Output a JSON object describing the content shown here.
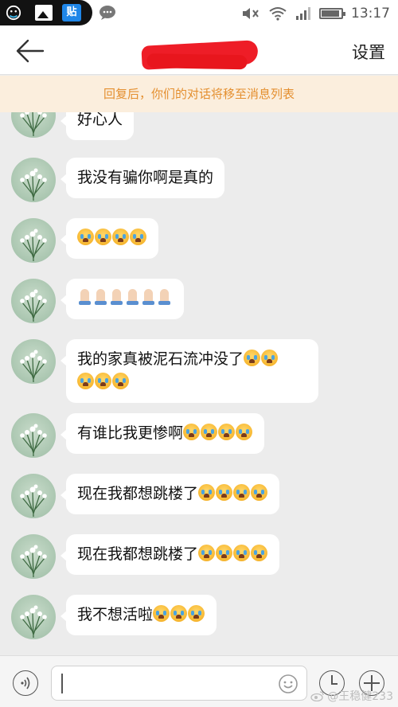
{
  "status_bar": {
    "left_icons": [
      "tie-icon",
      "image-icon",
      "tieba-icon",
      "chat-icon"
    ],
    "tieba_label": "贴",
    "right_icons": [
      "mute-icon",
      "wifi-icon",
      "signal-icon",
      "battery-icon"
    ],
    "time": "13:17"
  },
  "header": {
    "back_icon": "back-arrow-icon",
    "title_redacted": true,
    "settings_label": "设置"
  },
  "banner": {
    "text": "回复后，你们的对话将移至消息列表"
  },
  "messages": [
    {
      "text": "好心人"
    },
    {
      "text": "我没有骗你啊是真的"
    },
    {
      "text": "",
      "emoji": [
        "crying",
        "crying",
        "crying",
        "crying"
      ]
    },
    {
      "text": "",
      "emoji": [
        "praying",
        "praying",
        "praying",
        "praying",
        "praying",
        "praying"
      ]
    },
    {
      "text": "我的家真被泥石流冲没了",
      "emoji": [
        "crying",
        "crying",
        "crying",
        "crying",
        "crying"
      ]
    },
    {
      "text": "有谁比我更惨啊",
      "emoji": [
        "crying",
        "crying",
        "crying",
        "crying"
      ]
    },
    {
      "text": "现在我都想跳楼了",
      "emoji": [
        "crying",
        "crying",
        "crying",
        "crying"
      ]
    },
    {
      "text": "现在我都想跳楼了",
      "emoji": [
        "crying",
        "crying",
        "crying",
        "crying"
      ]
    },
    {
      "text": "我不想活啦",
      "emoji": [
        "crying",
        "crying",
        "crying"
      ]
    }
  ],
  "input_bar": {
    "voice_icon": "voice-icon",
    "input_value": "",
    "emoji_icon": "smiley-icon",
    "clock_icon": "clock-icon",
    "plus_icon": "plus-icon"
  },
  "watermark": {
    "text": "@王稳健233"
  }
}
